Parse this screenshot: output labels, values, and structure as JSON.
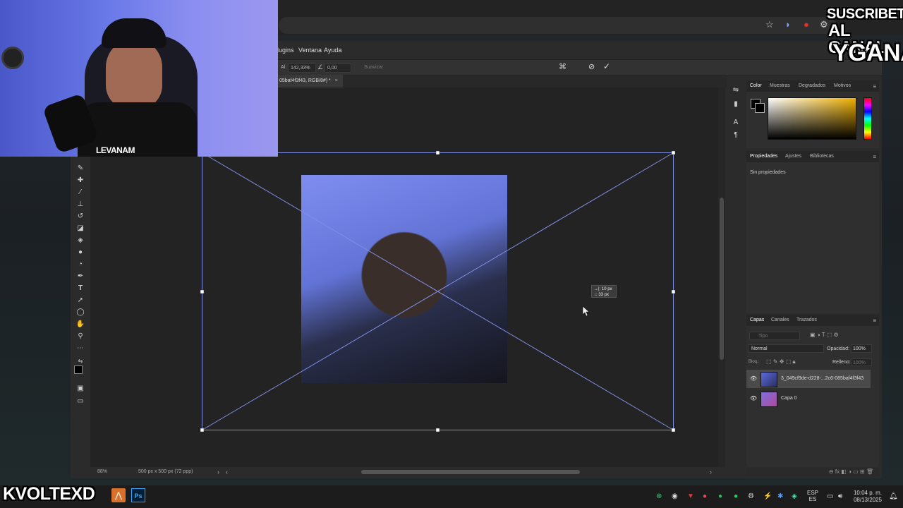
{
  "overlay": {
    "subscribe_line1": "SUSCRIBETE",
    "subscribe_line2": "AL CANAL",
    "subscribe_line3": "YGANA",
    "streamer_tag": "KVOLTEXD",
    "shirt_text": "LEVANAM"
  },
  "photoshop": {
    "menu": [
      "lugins",
      "Ventana",
      "Ayuda"
    ],
    "options": {
      "height_label": "Al:",
      "height_value": "142,33%",
      "angle_icon": "angle-icon",
      "angle_value": "0,00",
      "smooth_label": "Suavizar"
    },
    "doc_tab_title": "05baf4f3f43, RGB/8#) *",
    "doc_tab_close": "×",
    "transform_tooltip": {
      "line1": "→|: 10 px",
      "line2": "↓: 33 px"
    },
    "status": {
      "zoom": "88%",
      "doc_info": "500 px x 500 px (72 ppp)",
      "arrow": "›",
      "scroll_left": "‹",
      "scroll_right": "›"
    },
    "color_panel": {
      "tabs": [
        "Color",
        "Muestras",
        "Degradados",
        "Motivos"
      ]
    },
    "properties_panel": {
      "tabs": [
        "Propiedades",
        "Ajustes",
        "Bibliotecas"
      ],
      "empty_text": "Sin propiedades"
    },
    "layers_panel": {
      "tabs": [
        "Capas",
        "Canales",
        "Trazados"
      ],
      "search_placeholder": "Tipo",
      "blend_mode": "Normal",
      "opacity_label": "Opacidad:",
      "opacity_value": "100%",
      "lock_label": "Bloq.:",
      "fill_label": "Relleno:",
      "fill_value": "100%",
      "layers": [
        {
          "name": "3_049cf9de-d228-...2c6-085baf4f3f43"
        },
        {
          "name": "Capa 0"
        }
      ]
    }
  },
  "taskbar": {
    "lang_top": "ESP",
    "lang_bottom": "ES",
    "time": "10:04 p. m.",
    "date": "08/13/2025",
    "ps_label": "Ps"
  },
  "colors": {
    "accent_blue": "#6d7df0",
    "transform_line": "#7f8fe6",
    "ps_bg": "#2b2b2b"
  }
}
